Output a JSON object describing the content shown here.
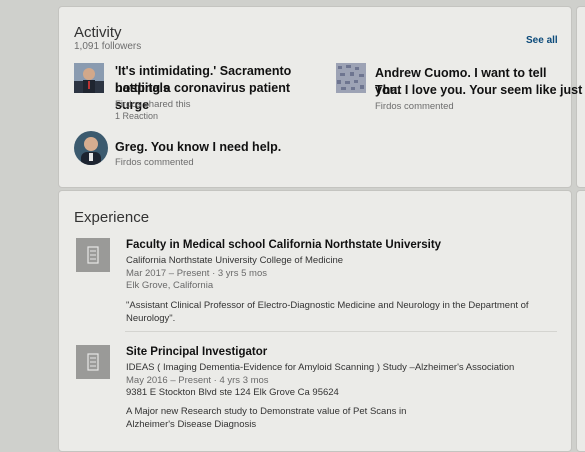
{
  "activity": {
    "title": "Activity",
    "followers": "1,091 followers",
    "see_all": "See all",
    "posts": [
      {
        "title_line1": "'It's intimidating.' Sacramento hospitals",
        "title_line2": "battling a coronavirus patient surge",
        "meta": "Firdos shared this",
        "reactions": "1 Reaction",
        "thumb_icon": "person-photo-icon"
      },
      {
        "title_line1": "Andrew Cuomo. I want to tell you.",
        "title_line2": "That I love you. Your seem like just a...",
        "meta": "Firdos commented",
        "thumb_icon": "pattern-image-icon"
      },
      {
        "title_line1": "Greg. You know I need help.",
        "meta": "Firdos commented",
        "thumb_icon": "profile-avatar-icon"
      }
    ]
  },
  "experience": {
    "title": "Experience",
    "items": [
      {
        "role": "Faculty in Medical school California Northstate University",
        "org": "California Northstate University College of Medicine",
        "dates": "Mar 2017 – Present · 3 yrs 5 mos",
        "location": "Elk Grove, California",
        "desc_line1": "\"Assistant Clinical Professor of Electro-Diagnostic Medicine and Neurology in the Department of",
        "desc_line2": "Neurology\".",
        "logo_icon": "building-icon"
      },
      {
        "role": "Site Principal Investigator",
        "org": "IDEAS ( Imaging Dementia-Evidence for Amyloid Scanning ) Study –Alzheimer's Association",
        "dates": "May 2016 – Present · 4 yrs 3 mos",
        "location": "9381 E Stockton Blvd ste 124 Elk Grove Ca 95624",
        "desc_line1": "A Major new Research study to Demonstrate value of Pet Scans in",
        "desc_line2": "Alzheimer's Disease Diagnosis",
        "logo_icon": "building-icon"
      }
    ]
  }
}
